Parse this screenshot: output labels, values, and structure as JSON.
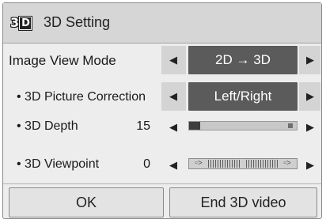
{
  "dialog": {
    "title": "3D Setting",
    "logo_text": "3D"
  },
  "rows": {
    "image_view_mode": {
      "label": "Image View Mode",
      "value": "2D → 3D"
    },
    "picture_correction": {
      "label": "• 3D Picture Correction",
      "value": "Left/Right"
    },
    "depth": {
      "label": "• 3D Depth",
      "value": "15",
      "level": 0.1
    },
    "viewpoint": {
      "label": "• 3D Viewpoint",
      "value": "0"
    }
  },
  "arrows": {
    "left": "◀",
    "right": "▶"
  },
  "buttons": {
    "ok": "OK",
    "end": "End 3D video"
  },
  "icons": {
    "logo": "3d-logo-icon",
    "left": "left-arrow-icon",
    "right": "right-arrow-icon"
  }
}
